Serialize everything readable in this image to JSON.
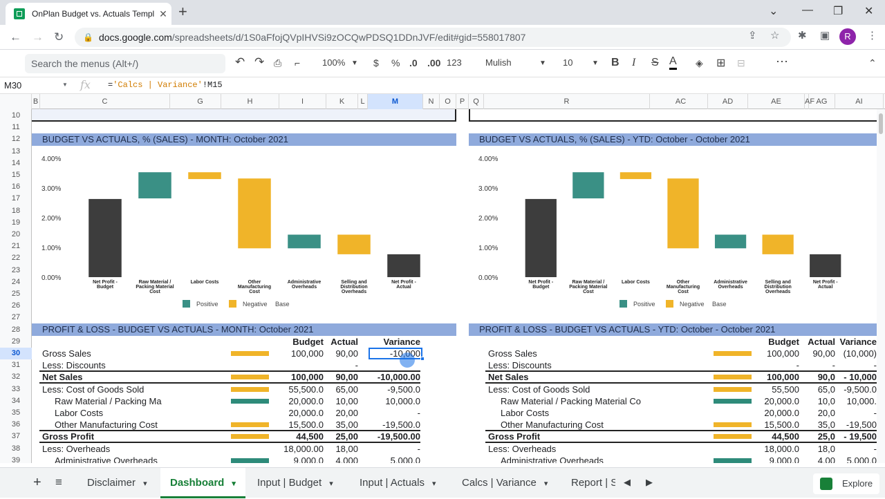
{
  "browser": {
    "tab_title": "OnPlan Budget vs. Actuals Templ",
    "url_host": "docs.google.com",
    "url_path": "/spreadsheets/d/1S0aFfojQVpIHVSi9zOCQwPDSQ1DDnJVF/edit#gid=558017807",
    "avatar_letter": "R"
  },
  "toolbar": {
    "menu_search_placeholder": "Search the menus (Alt+/)",
    "zoom": "100%",
    "currency": "$",
    "percent": "%",
    "dec_decrease": ".0",
    "dec_increase": ".00",
    "format_more": "123",
    "font": "Mulish",
    "font_size": "10",
    "bold": "B",
    "italic": "I",
    "strike": "S",
    "text_color": "A"
  },
  "formula_bar": {
    "cell_ref": "M30",
    "fx": "fx",
    "prefix": "=",
    "formula_str": "'Calcs | Variance'",
    "formula_rest": "!M15"
  },
  "columns": [
    "B",
    "C",
    "G",
    "H",
    "I",
    "K",
    "L",
    "M",
    "N",
    "O",
    "P",
    "Q",
    "R",
    "AC",
    "AD",
    "AE",
    "AF",
    "AG",
    "AI"
  ],
  "rows": [
    "10",
    "11",
    "12",
    "13",
    "14",
    "15",
    "16",
    "17",
    "18",
    "19",
    "20",
    "21",
    "22",
    "23",
    "24",
    "25",
    "26",
    "27",
    "28",
    "29",
    "30",
    "31",
    "32",
    "33",
    "34",
    "35",
    "36",
    "37",
    "38",
    "39"
  ],
  "left_chart": {
    "header": "BUDGET VS ACTUALS, % (SALES) - MONTH: October 2021",
    "chart_data": {
      "type": "bar",
      "categories": [
        "Net Profit - Budget",
        "Raw Material / Packing Material Cost",
        "Labor Costs",
        "Other Manufacturing Cost",
        "Administrative Overheads",
        "Selling and Distribution Overheads",
        "Net Profit - Actual"
      ],
      "series": [
        {
          "name": "Positive",
          "ranges": [
            null,
            [
              2.65,
              3.53
            ],
            null,
            null,
            [
              0.97,
              1.43
            ],
            null,
            null
          ]
        },
        {
          "name": "Negative",
          "ranges": [
            null,
            null,
            [
              3.3,
              3.53
            ],
            [
              0.97,
              3.32
            ],
            null,
            [
              0.77,
              1.43
            ],
            null
          ]
        },
        {
          "name": "Base",
          "ranges": [
            [
              0,
              2.63
            ],
            null,
            null,
            null,
            null,
            null,
            [
              0,
              0.77
            ]
          ]
        }
      ],
      "yticks": [
        "4.00%",
        "3.00%",
        "2.00%",
        "1.00%",
        "0.00%"
      ],
      "ylim": [
        0,
        4
      ],
      "colors": {
        "Positive": "#3a9085",
        "Negative": "#f0b429",
        "Base": "#3d3d3d"
      }
    }
  },
  "right_chart": {
    "header": "BUDGET VS ACTUALS, % (SALES) - YTD: October - October 2021",
    "chart_data": {
      "type": "bar",
      "categories": [
        "Net Profit - Budget",
        "Raw Material / Packing Material Cost",
        "Labor Costs",
        "Other Manufacturing Cost",
        "Administrative Overheads",
        "Selling and Distribution Overheads",
        "Net Profit - Actual"
      ],
      "series": [
        {
          "name": "Positive",
          "ranges": [
            null,
            [
              2.65,
              3.53
            ],
            null,
            null,
            [
              0.97,
              1.43
            ],
            null,
            null
          ]
        },
        {
          "name": "Negative",
          "ranges": [
            null,
            null,
            [
              3.3,
              3.53
            ],
            [
              0.97,
              3.32
            ],
            null,
            [
              0.77,
              1.43
            ],
            null
          ]
        },
        {
          "name": "Base",
          "ranges": [
            [
              0,
              2.63
            ],
            null,
            null,
            null,
            null,
            null,
            [
              0,
              0.77
            ]
          ]
        }
      ],
      "yticks": [
        "4.00%",
        "3.00%",
        "2.00%",
        "1.00%",
        "0.00%"
      ],
      "ylim": [
        0,
        4
      ],
      "colors": {
        "Positive": "#3a9085",
        "Negative": "#f0b429",
        "Base": "#3d3d3d"
      }
    }
  },
  "pl_left": {
    "header": "PROFIT & LOSS - BUDGET VS ACTUALS - MONTH: October 2021",
    "col_budget": "Budget",
    "col_actual": "Actual",
    "col_variance": "Variance",
    "rows": [
      {
        "label": "Gross Sales",
        "budget": "100,000",
        "actual": "90,00",
        "variance": "-10,000",
        "bar": "yel"
      },
      {
        "label": "Less: Discounts",
        "budget": "",
        "actual": "-",
        "variance": "",
        "bar": ""
      },
      {
        "label": "Net Sales",
        "budget": "100,000",
        "actual": "90,00",
        "variance": "-10,000.00",
        "bar": "yel",
        "bold": true
      },
      {
        "label": "Less: Cost of Goods Sold",
        "budget": "55,500.0",
        "actual": "65,00",
        "variance": "-9,500.0",
        "bar": "yel"
      },
      {
        "label": "Raw Material / Packing Ma",
        "budget": "20,000.0",
        "actual": "10,00",
        "variance": "10,000.0",
        "bar": "teal",
        "indent": true
      },
      {
        "label": "Labor Costs",
        "budget": "20,000.0",
        "actual": "20,00",
        "variance": "-",
        "bar": "",
        "indent": true
      },
      {
        "label": "Other Manufacturing Cost",
        "budget": "15,500.0",
        "actual": "35,00",
        "variance": "-19,500.0",
        "bar": "yel",
        "indent": true
      },
      {
        "label": "Gross Profit",
        "budget": "44,500",
        "actual": "25,00",
        "variance": "-19,500.00",
        "bar": "yel",
        "bold": true
      },
      {
        "label": "Less: Overheads",
        "budget": "18,000.00",
        "actual": "18,00",
        "variance": "-",
        "bar": ""
      },
      {
        "label": "Administrative Overheads",
        "budget": "9,000.0",
        "actual": "4,000",
        "variance": "5,000.0",
        "bar": "teal",
        "indent": true
      }
    ]
  },
  "pl_right": {
    "header": "PROFIT & LOSS - BUDGET VS ACTUALS - YTD: October - October 2021",
    "col_budget": "Budget",
    "col_actual": "Actual",
    "col_variance": "Variance",
    "rows": [
      {
        "label": "Gross Sales",
        "budget": "100,000",
        "actual": "90,00",
        "variance": "(10,000)",
        "bar": "yel"
      },
      {
        "label": "Less: Discounts",
        "budget": "-",
        "actual": "-",
        "variance": "-",
        "bar": ""
      },
      {
        "label": "Net Sales",
        "budget": "100,000",
        "actual": "90,0",
        "variance": "- 10,000",
        "bar": "yel",
        "bold": true
      },
      {
        "label": "Less: Cost of Goods Sold",
        "budget": "55,500",
        "actual": "65,0",
        "variance": "-9,500.0",
        "bar": "yel"
      },
      {
        "label": "Raw Material / Packing Material Co",
        "budget": "20,000.0",
        "actual": "10,0",
        "variance": "10,000.",
        "bar": "teal",
        "indent": true
      },
      {
        "label": "Labor Costs",
        "budget": "20,000.0",
        "actual": "20,0",
        "variance": "-",
        "bar": "",
        "indent": true
      },
      {
        "label": "Other Manufacturing Cost",
        "budget": "15,500.0",
        "actual": "35,0",
        "variance": "-19,500",
        "bar": "yel",
        "indent": true
      },
      {
        "label": "Gross Profit",
        "budget": "44,500",
        "actual": "25,0",
        "variance": "- 19,500",
        "bar": "yel",
        "bold": true
      },
      {
        "label": "Less: Overheads",
        "budget": "18,000.0",
        "actual": "18,0",
        "variance": "-",
        "bar": ""
      },
      {
        "label": "Administrative Overheads",
        "budget": "9,000.0",
        "actual": "4,00",
        "variance": "5,000.0",
        "bar": "teal",
        "indent": true
      }
    ]
  },
  "sheets": {
    "tabs": [
      "Disclaimer",
      "Dashboard",
      "Input | Budget",
      "Input | Actuals",
      "Calcs | Variance",
      "Report | S"
    ],
    "active": "Dashboard",
    "explore": "Explore"
  }
}
